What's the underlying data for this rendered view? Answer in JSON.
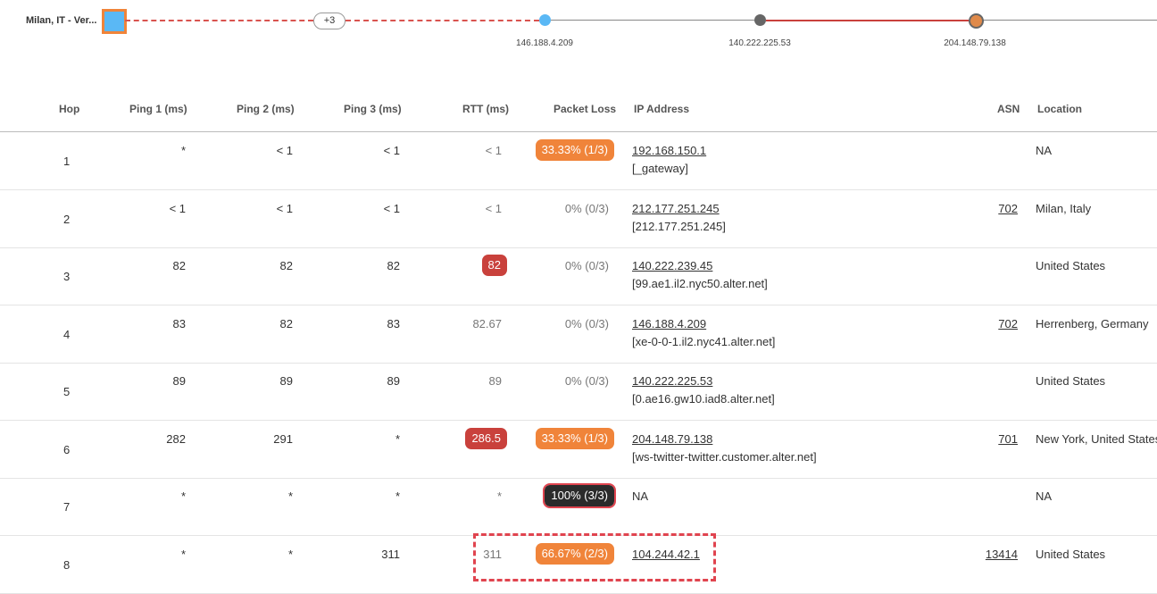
{
  "path": {
    "source_label": "Milan, IT - Ver...",
    "hidden_hops_label": "+3",
    "nodes": [
      "146.188.4.209",
      "140.222.225.53",
      "204.148.79.138"
    ]
  },
  "table": {
    "headers": {
      "hop": "Hop",
      "ping1": "Ping 1 (ms)",
      "ping2": "Ping 2 (ms)",
      "ping3": "Ping 3 (ms)",
      "rtt": "RTT (ms)",
      "loss": "Packet Loss",
      "ip": "IP Address",
      "asn": "ASN",
      "location": "Location"
    },
    "rows": [
      {
        "hop": "1",
        "p1": "*",
        "p2": "< 1",
        "p3": "< 1",
        "rtt": "< 1",
        "loss": "33.33% (1/3)",
        "ip": "192.168.150.1",
        "host": "[_gateway]",
        "asn": "",
        "loc": "NA"
      },
      {
        "hop": "2",
        "p1": "< 1",
        "p2": "< 1",
        "p3": "< 1",
        "rtt": "< 1",
        "loss": "0% (0/3)",
        "ip": "212.177.251.245",
        "host": "[212.177.251.245]",
        "asn": "702",
        "loc": "Milan, Italy"
      },
      {
        "hop": "3",
        "p1": "82",
        "p2": "82",
        "p3": "82",
        "rtt": "82",
        "loss": "0% (0/3)",
        "ip": "140.222.239.45",
        "host": "[99.ae1.il2.nyc50.alter.net]",
        "asn": "",
        "loc": "United States"
      },
      {
        "hop": "4",
        "p1": "83",
        "p2": "82",
        "p3": "83",
        "rtt": "82.67",
        "loss": "0% (0/3)",
        "ip": "146.188.4.209",
        "host": "[xe-0-0-1.il2.nyc41.alter.net]",
        "asn": "702",
        "loc": "Herrenberg, Germany"
      },
      {
        "hop": "5",
        "p1": "89",
        "p2": "89",
        "p3": "89",
        "rtt": "89",
        "loss": "0% (0/3)",
        "ip": "140.222.225.53",
        "host": "[0.ae16.gw10.iad8.alter.net]",
        "asn": "",
        "loc": "United States"
      },
      {
        "hop": "6",
        "p1": "282",
        "p2": "291",
        "p3": "*",
        "rtt": "286.5",
        "loss": "33.33% (1/3)",
        "ip": "204.148.79.138",
        "host": "[ws-twitter-twitter.customer.alter.net]",
        "asn": "701",
        "loc": "New York, United States"
      },
      {
        "hop": "7",
        "p1": "*",
        "p2": "*",
        "p3": "*",
        "rtt": "*",
        "loss": "100% (3/3)",
        "ip": "NA",
        "host": "",
        "asn": "",
        "loc": "NA"
      },
      {
        "hop": "8",
        "p1": "*",
        "p2": "*",
        "p3": "311",
        "rtt": "311",
        "loss": "66.67% (2/3)",
        "ip": "104.244.42.1",
        "host": "",
        "asn": "13414",
        "loc": "United States"
      }
    ]
  },
  "colors": {
    "accent_orange": "#f0843a",
    "alert_red": "#c9413c",
    "node_blue": "#5ab8f5"
  }
}
